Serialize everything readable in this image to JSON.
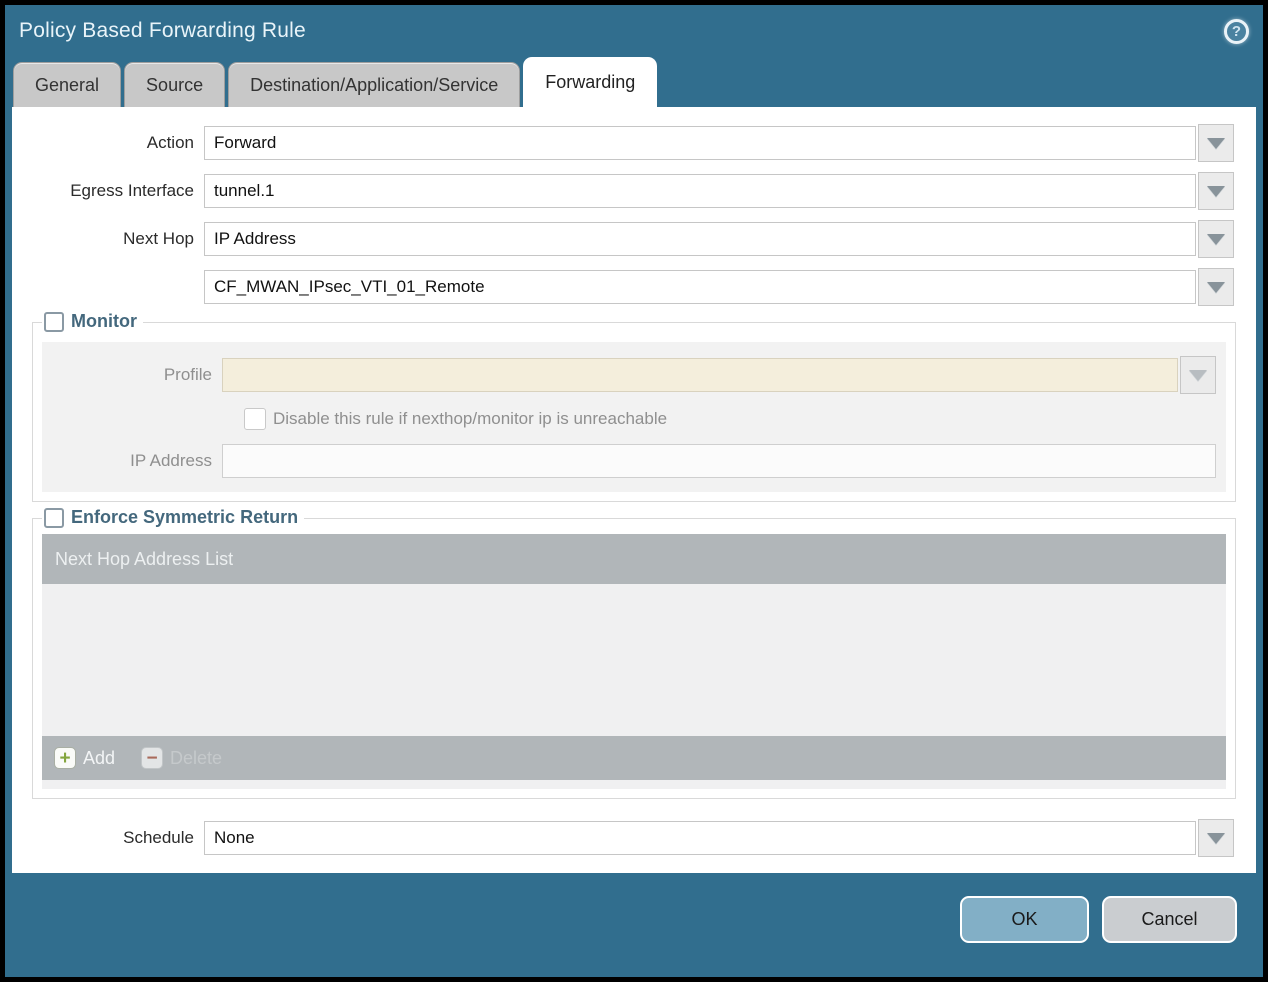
{
  "dialog": {
    "title": "Policy Based Forwarding Rule",
    "help_glyph": "?"
  },
  "tabs": [
    {
      "label": "General",
      "active": false
    },
    {
      "label": "Source",
      "active": false
    },
    {
      "label": "Destination/Application/Service",
      "active": false
    },
    {
      "label": "Forwarding",
      "active": true
    }
  ],
  "form": {
    "action": {
      "label": "Action",
      "value": "Forward"
    },
    "egress_interface": {
      "label": "Egress Interface",
      "value": "tunnel.1"
    },
    "next_hop": {
      "label": "Next Hop",
      "value": "IP Address"
    },
    "next_hop_address": {
      "value": "CF_MWAN_IPsec_VTI_01_Remote"
    },
    "schedule": {
      "label": "Schedule",
      "value": "None"
    }
  },
  "monitor": {
    "legend": "Monitor",
    "checked": false,
    "profile": {
      "label": "Profile",
      "value": ""
    },
    "disable_rule_label": "Disable this rule if nexthop/monitor ip is unreachable",
    "disable_rule_checked": false,
    "ip_address": {
      "label": "IP Address",
      "value": ""
    }
  },
  "symmetric_return": {
    "legend": "Enforce Symmetric Return",
    "checked": false,
    "table_header": "Next Hop Address List",
    "rows": [],
    "add_label": "Add",
    "add_glyph": "+",
    "delete_label": "Delete",
    "delete_glyph": "−"
  },
  "footer": {
    "ok_label": "OK",
    "cancel_label": "Cancel"
  },
  "colors": {
    "dialog_teal": "#316E8E",
    "active_tab": "#FFFFFF",
    "inactive_tab": "#C8C8C8",
    "disabled_field_beige": "#F4EEDC",
    "table_gray": "#B1B6B9",
    "ok_button": "#82AFC6",
    "cancel_button": "#CACDD0",
    "add_icon_green": "#84A63E",
    "delete_icon_red": "#A96A5B",
    "legend_slate": "#44687D"
  }
}
